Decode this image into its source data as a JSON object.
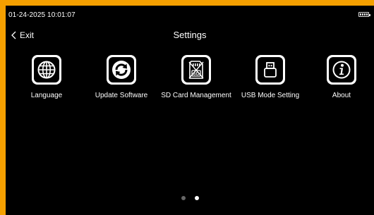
{
  "status_bar": {
    "datetime": "01-24-2025 10:01:07",
    "battery_icon": "battery-full-icon"
  },
  "header": {
    "back_label": "Exit",
    "back_icon": "chevron-left-icon",
    "title": "Settings"
  },
  "menu": {
    "items": [
      {
        "label": "Language",
        "icon": "globe-icon"
      },
      {
        "label": "Update Software",
        "icon": "refresh-icon"
      },
      {
        "label": "SD Card Management",
        "icon": "sd-card-icon"
      },
      {
        "label": "USB Mode Setting",
        "icon": "usb-icon"
      },
      {
        "label": "About",
        "icon": "info-icon"
      }
    ]
  },
  "pagination": {
    "pages": 2,
    "current_page": 2
  },
  "colors": {
    "frame": "#f5a000",
    "background": "#000000",
    "foreground": "#ffffff",
    "inactive_dot": "#666666"
  }
}
